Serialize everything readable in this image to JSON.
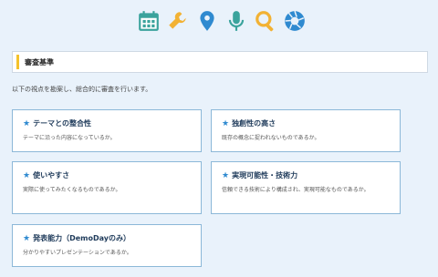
{
  "icons": [
    {
      "name": "calendar-icon",
      "color": "#3aa39c"
    },
    {
      "name": "wrench-icon",
      "color": "#f2b234"
    },
    {
      "name": "location-pin-icon",
      "color": "#2f8ad0"
    },
    {
      "name": "microphone-icon",
      "color": "#3aa39c"
    },
    {
      "name": "search-icon",
      "color": "#f2b234"
    },
    {
      "name": "aperture-icon",
      "color": "#2f8ad0"
    }
  ],
  "section": {
    "title": "審査基準",
    "accent": "#f4c22b"
  },
  "intro": "以下の視点を勘案し、総合的に審査を行います。",
  "criteria": [
    {
      "title": "テーマとの整合性",
      "desc": "テーマに沿った内容になっているか。"
    },
    {
      "title": "独創性の高さ",
      "desc": "既存の概念に捉われないものであるか。"
    },
    {
      "title": "使いやすさ",
      "desc": "実際に使ってみたくなるものであるか。"
    },
    {
      "title": "実現可能性・技術力",
      "desc": "信頼できる技術により構成され、実現可能なものであるか。"
    },
    {
      "title": "発表能力（DemoDayのみ）",
      "desc": "分かりやすいプレゼンテーションであるか。"
    }
  ],
  "star_glyph": "★"
}
